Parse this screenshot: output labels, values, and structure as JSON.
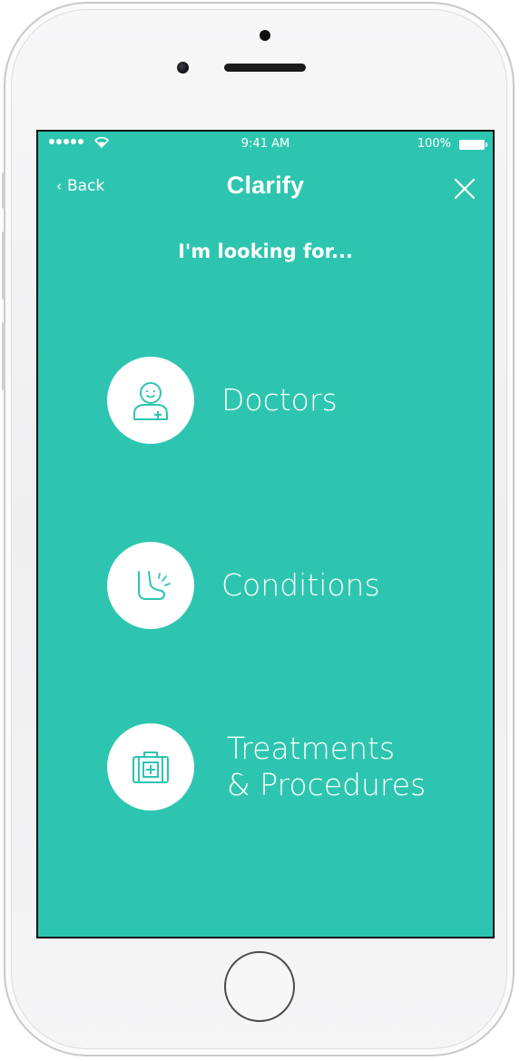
{
  "status_bar": {
    "time": "9:41 AM",
    "battery": "100%"
  },
  "nav": {
    "back_label": "Back",
    "title": "Clarify"
  },
  "prompt": "I'm looking for...",
  "options": [
    {
      "label": "Doctors",
      "icon": "doctor-icon"
    },
    {
      "label": "Conditions",
      "icon": "foot-icon"
    },
    {
      "label": "Treatments\n& Procedures",
      "icon": "medical-kit-icon"
    }
  ],
  "colors": {
    "accent": "#2ec5b0",
    "white": "#ffffff"
  }
}
